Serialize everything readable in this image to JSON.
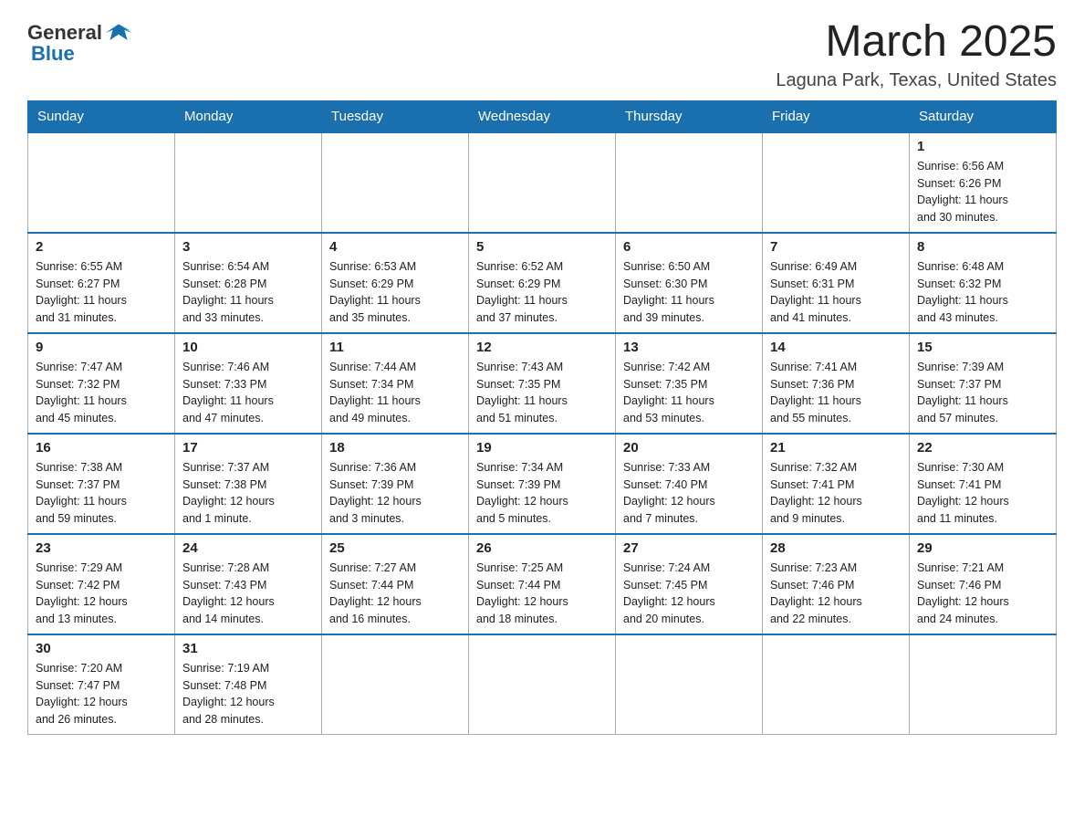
{
  "header": {
    "logo_general": "General",
    "logo_blue": "Blue",
    "month": "March 2025",
    "location": "Laguna Park, Texas, United States"
  },
  "weekdays": [
    "Sunday",
    "Monday",
    "Tuesday",
    "Wednesday",
    "Thursday",
    "Friday",
    "Saturday"
  ],
  "weeks": [
    [
      {
        "day": "",
        "info": ""
      },
      {
        "day": "",
        "info": ""
      },
      {
        "day": "",
        "info": ""
      },
      {
        "day": "",
        "info": ""
      },
      {
        "day": "",
        "info": ""
      },
      {
        "day": "",
        "info": ""
      },
      {
        "day": "1",
        "info": "Sunrise: 6:56 AM\nSunset: 6:26 PM\nDaylight: 11 hours\nand 30 minutes."
      }
    ],
    [
      {
        "day": "2",
        "info": "Sunrise: 6:55 AM\nSunset: 6:27 PM\nDaylight: 11 hours\nand 31 minutes."
      },
      {
        "day": "3",
        "info": "Sunrise: 6:54 AM\nSunset: 6:28 PM\nDaylight: 11 hours\nand 33 minutes."
      },
      {
        "day": "4",
        "info": "Sunrise: 6:53 AM\nSunset: 6:29 PM\nDaylight: 11 hours\nand 35 minutes."
      },
      {
        "day": "5",
        "info": "Sunrise: 6:52 AM\nSunset: 6:29 PM\nDaylight: 11 hours\nand 37 minutes."
      },
      {
        "day": "6",
        "info": "Sunrise: 6:50 AM\nSunset: 6:30 PM\nDaylight: 11 hours\nand 39 minutes."
      },
      {
        "day": "7",
        "info": "Sunrise: 6:49 AM\nSunset: 6:31 PM\nDaylight: 11 hours\nand 41 minutes."
      },
      {
        "day": "8",
        "info": "Sunrise: 6:48 AM\nSunset: 6:32 PM\nDaylight: 11 hours\nand 43 minutes."
      }
    ],
    [
      {
        "day": "9",
        "info": "Sunrise: 7:47 AM\nSunset: 7:32 PM\nDaylight: 11 hours\nand 45 minutes."
      },
      {
        "day": "10",
        "info": "Sunrise: 7:46 AM\nSunset: 7:33 PM\nDaylight: 11 hours\nand 47 minutes."
      },
      {
        "day": "11",
        "info": "Sunrise: 7:44 AM\nSunset: 7:34 PM\nDaylight: 11 hours\nand 49 minutes."
      },
      {
        "day": "12",
        "info": "Sunrise: 7:43 AM\nSunset: 7:35 PM\nDaylight: 11 hours\nand 51 minutes."
      },
      {
        "day": "13",
        "info": "Sunrise: 7:42 AM\nSunset: 7:35 PM\nDaylight: 11 hours\nand 53 minutes."
      },
      {
        "day": "14",
        "info": "Sunrise: 7:41 AM\nSunset: 7:36 PM\nDaylight: 11 hours\nand 55 minutes."
      },
      {
        "day": "15",
        "info": "Sunrise: 7:39 AM\nSunset: 7:37 PM\nDaylight: 11 hours\nand 57 minutes."
      }
    ],
    [
      {
        "day": "16",
        "info": "Sunrise: 7:38 AM\nSunset: 7:37 PM\nDaylight: 11 hours\nand 59 minutes."
      },
      {
        "day": "17",
        "info": "Sunrise: 7:37 AM\nSunset: 7:38 PM\nDaylight: 12 hours\nand 1 minute."
      },
      {
        "day": "18",
        "info": "Sunrise: 7:36 AM\nSunset: 7:39 PM\nDaylight: 12 hours\nand 3 minutes."
      },
      {
        "day": "19",
        "info": "Sunrise: 7:34 AM\nSunset: 7:39 PM\nDaylight: 12 hours\nand 5 minutes."
      },
      {
        "day": "20",
        "info": "Sunrise: 7:33 AM\nSunset: 7:40 PM\nDaylight: 12 hours\nand 7 minutes."
      },
      {
        "day": "21",
        "info": "Sunrise: 7:32 AM\nSunset: 7:41 PM\nDaylight: 12 hours\nand 9 minutes."
      },
      {
        "day": "22",
        "info": "Sunrise: 7:30 AM\nSunset: 7:41 PM\nDaylight: 12 hours\nand 11 minutes."
      }
    ],
    [
      {
        "day": "23",
        "info": "Sunrise: 7:29 AM\nSunset: 7:42 PM\nDaylight: 12 hours\nand 13 minutes."
      },
      {
        "day": "24",
        "info": "Sunrise: 7:28 AM\nSunset: 7:43 PM\nDaylight: 12 hours\nand 14 minutes."
      },
      {
        "day": "25",
        "info": "Sunrise: 7:27 AM\nSunset: 7:44 PM\nDaylight: 12 hours\nand 16 minutes."
      },
      {
        "day": "26",
        "info": "Sunrise: 7:25 AM\nSunset: 7:44 PM\nDaylight: 12 hours\nand 18 minutes."
      },
      {
        "day": "27",
        "info": "Sunrise: 7:24 AM\nSunset: 7:45 PM\nDaylight: 12 hours\nand 20 minutes."
      },
      {
        "day": "28",
        "info": "Sunrise: 7:23 AM\nSunset: 7:46 PM\nDaylight: 12 hours\nand 22 minutes."
      },
      {
        "day": "29",
        "info": "Sunrise: 7:21 AM\nSunset: 7:46 PM\nDaylight: 12 hours\nand 24 minutes."
      }
    ],
    [
      {
        "day": "30",
        "info": "Sunrise: 7:20 AM\nSunset: 7:47 PM\nDaylight: 12 hours\nand 26 minutes."
      },
      {
        "day": "31",
        "info": "Sunrise: 7:19 AM\nSunset: 7:48 PM\nDaylight: 12 hours\nand 28 minutes."
      },
      {
        "day": "",
        "info": ""
      },
      {
        "day": "",
        "info": ""
      },
      {
        "day": "",
        "info": ""
      },
      {
        "day": "",
        "info": ""
      },
      {
        "day": "",
        "info": ""
      }
    ]
  ]
}
